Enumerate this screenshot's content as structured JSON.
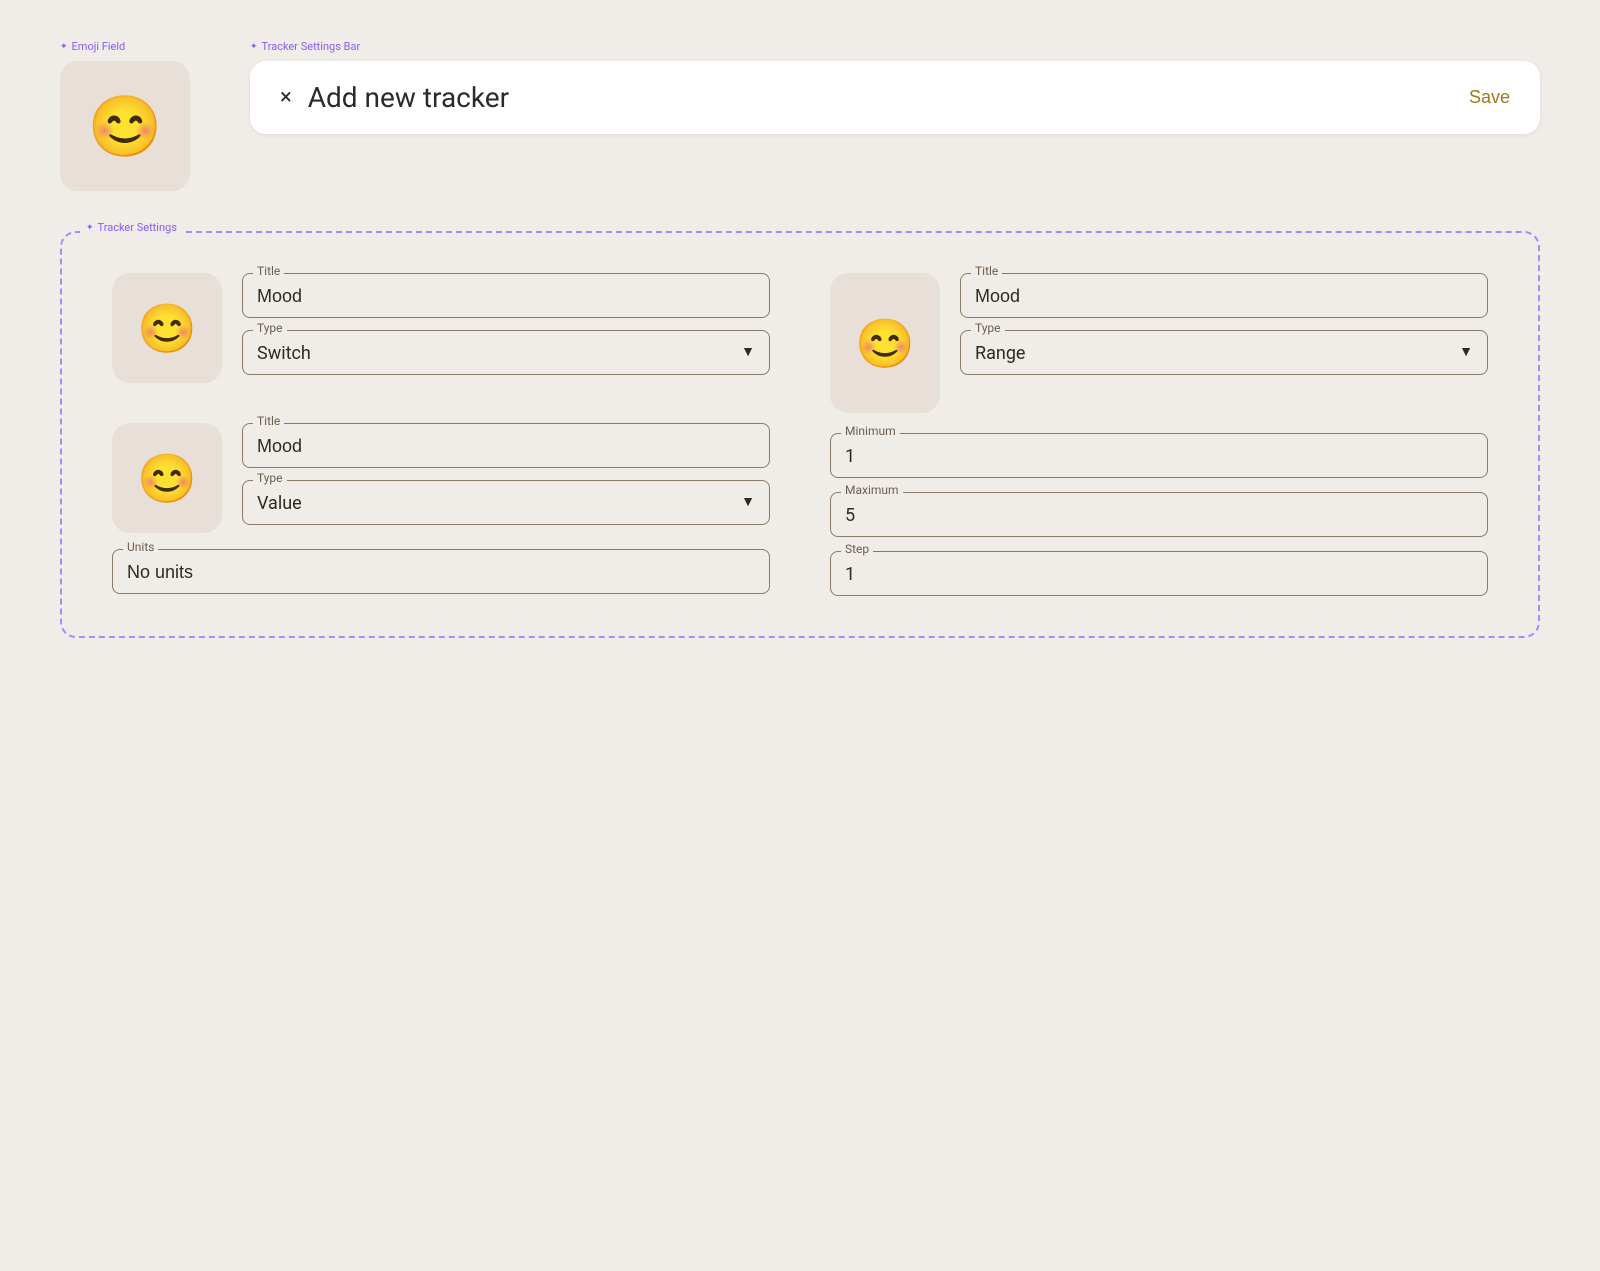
{
  "annotations": {
    "emoji_field_label": "Emoji Field",
    "tracker_settings_bar_label": "Tracker Settings Bar",
    "tracker_settings_label": "Tracker Settings"
  },
  "header": {
    "close_label": "×",
    "title": "Add new tracker",
    "save_label": "Save"
  },
  "emoji_top": {
    "emoji": "😊"
  },
  "left_tracker_1": {
    "emoji": "😊",
    "title_label": "Title",
    "title_value": "Mood",
    "type_label": "Type",
    "type_value": "Switch"
  },
  "left_tracker_2": {
    "emoji": "😊",
    "title_label": "Title",
    "title_value": "Mood",
    "type_label": "Type",
    "type_value": "Value",
    "units_label": "Units",
    "units_value": "No units"
  },
  "right_tracker": {
    "emoji": "😊",
    "title_label": "Title",
    "title_value": "Mood",
    "type_label": "Type",
    "type_value": "Range",
    "min_label": "Minimum",
    "min_value": "1",
    "max_label": "Maximum",
    "max_value": "5",
    "step_label": "Step",
    "step_value": "1"
  }
}
